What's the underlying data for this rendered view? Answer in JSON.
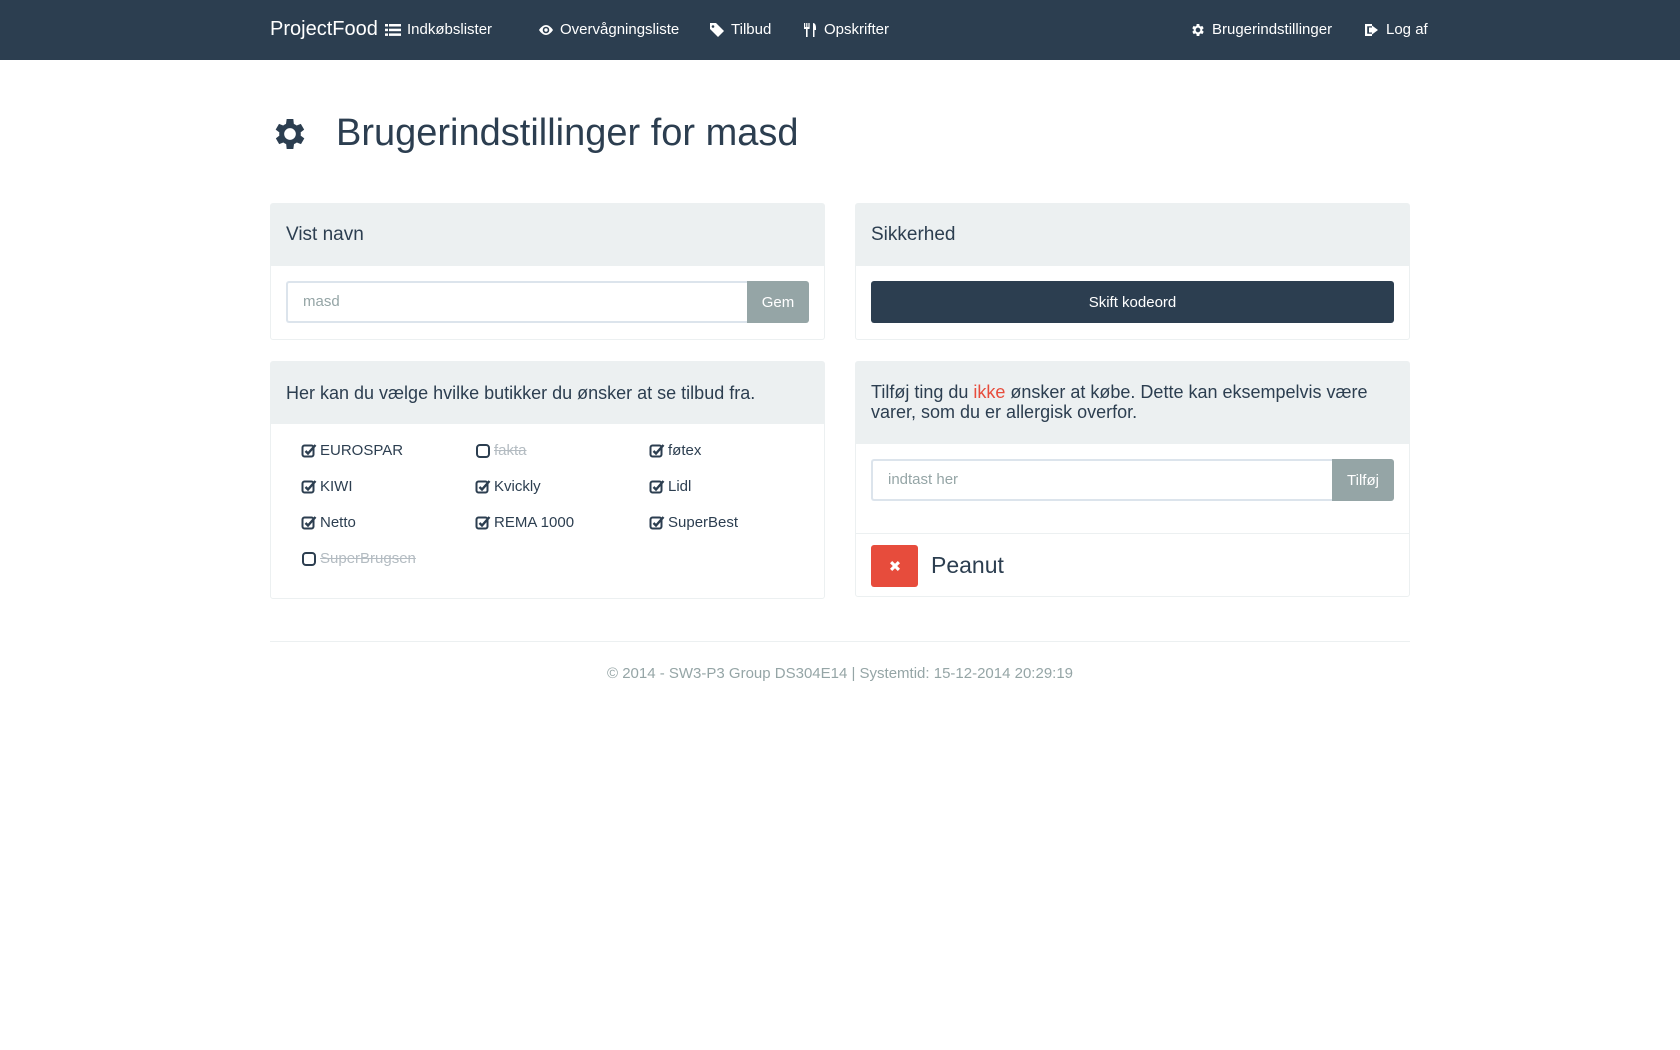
{
  "navbar": {
    "brand": "ProjectFood",
    "items": [
      {
        "label": "Indkøbslister",
        "icon": "list-icon"
      },
      {
        "label": "Overvågningsliste",
        "icon": "eye-icon"
      },
      {
        "label": "Tilbud",
        "icon": "tags-icon"
      },
      {
        "label": "Opskrifter",
        "icon": "cutlery-icon"
      }
    ],
    "right_items": [
      {
        "label": "Brugerindstillinger",
        "icon": "gear-icon"
      },
      {
        "label": "Log af",
        "icon": "sign-out-icon"
      }
    ]
  },
  "page": {
    "title": "Brugerindstillinger for masd",
    "icon": "gear-icon"
  },
  "display_name_panel": {
    "heading": "Vist navn",
    "input_value": "masd",
    "save_label": "Gem"
  },
  "security_panel": {
    "heading": "Sikkerhed",
    "change_password_label": "Skift kodeord"
  },
  "stores_panel": {
    "heading": "Her kan du vælge hvilke butikker du ønsker at se tilbud fra.",
    "stores": [
      {
        "name": "EUROSPAR",
        "checked": true
      },
      {
        "name": "fakta",
        "checked": false
      },
      {
        "name": "føtex",
        "checked": true
      },
      {
        "name": "KIWI",
        "checked": true
      },
      {
        "name": "Kvickly",
        "checked": true
      },
      {
        "name": "Lidl",
        "checked": true
      },
      {
        "name": "Netto",
        "checked": true
      },
      {
        "name": "REMA 1000",
        "checked": true
      },
      {
        "name": "SuperBest",
        "checked": true
      },
      {
        "name": "SuperBrugsen",
        "checked": false
      }
    ]
  },
  "exclude_panel": {
    "heading_part1": "Tilføj ting du ",
    "heading_highlight": "ikke",
    "heading_part2": " ønsker at købe. Dette kan eksempelvis være varer, som du er allergisk overfor.",
    "input_placeholder": "indtast her",
    "add_label": "Tilføj",
    "items": [
      "Peanut"
    ]
  },
  "footer": {
    "text": "© 2014 - SW3-P3 Group DS304E14 | Systemtid: 15-12-2014 20:29:19"
  },
  "colors": {
    "navbar": "#2c3e50",
    "muted": "#95a5a6",
    "danger": "#e74c3c",
    "panel_heading": "#ecf0f1"
  }
}
